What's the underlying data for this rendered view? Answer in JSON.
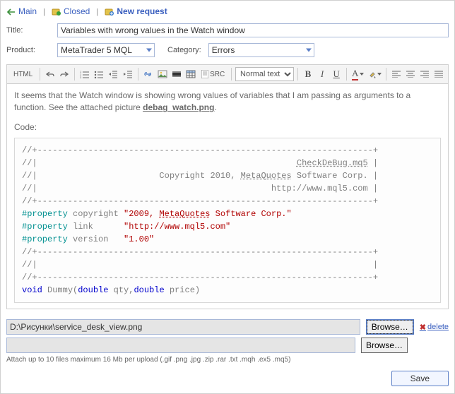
{
  "nav": {
    "main": "Main",
    "closed": "Closed",
    "new": "New request"
  },
  "labels": {
    "title": "Title:",
    "product": "Product:",
    "category": "Category:",
    "code": "Code:"
  },
  "fields": {
    "title": "Variables with wrong values in the Watch window",
    "product": "MetaTrader 5 MQL",
    "category": "Errors"
  },
  "toolbar": {
    "html": "HTML",
    "src": "SRC",
    "format": "Normal text",
    "bold": "B",
    "italic": "I",
    "underline": "U",
    "a": "A"
  },
  "body": {
    "text": "It seems that the Watch window is showing wrong values of variables that I am passing as arguments to a function. See the attached picture ",
    "attachment": "debag_watch.png"
  },
  "code": {
    "l1": "//+------------------------------------------------------------------+",
    "l2a": "//|                                                   ",
    "l2b": "CheckDeBug.mq5",
    "l2c": " |",
    "l3a": "//|                        Copyright 2010, ",
    "l3b": "MetaQuotes",
    "l3c": " Software Corp. |",
    "l4": "//|                                              http://www.mql5.com |",
    "l5": "//+------------------------------------------------------------------+",
    "p1a": "#property",
    "p1b": " copyright ",
    "p1c": "\"2009, ",
    "p1d": "MetaQuotes",
    "p1e": " Software Corp.\"",
    "p2a": "#property",
    "p2b": " link      ",
    "p2c": "\"http://www.mql5.com\"",
    "p3a": "#property",
    "p3b": " version   ",
    "p3c": "\"1.00\"",
    "l6": "//+------------------------------------------------------------------+",
    "l7": "//|                                                                  |",
    "l8": "//+------------------------------------------------------------------+",
    "fa": "void",
    "fb": " Dummy(",
    "fc": "double",
    "fd": " qty,",
    "fe": "double",
    "ff": " price)"
  },
  "files": {
    "path1": "D:\\Рисунки\\service_desk_view.png",
    "path2": "",
    "browse": "Browse…",
    "delete": "delete",
    "hint": "Attach up to 10 files maximum 16 Mb per upload (.gif .png .jpg .zip .rar .txt .mqh .ex5 .mq5)"
  },
  "save": "Save"
}
